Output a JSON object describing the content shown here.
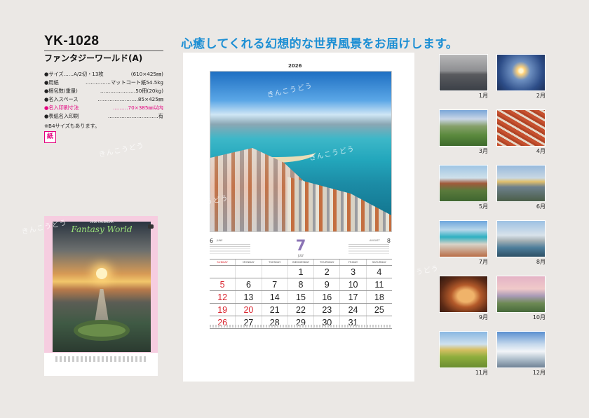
{
  "product": {
    "code": "YK-1028",
    "name": "ファンタジーワールド(A)",
    "specs": [
      {
        "label": "●サイズ……A/2切・13枚",
        "value": "(610×425㎜)",
        "highlight": false
      },
      {
        "label": "●用紙",
        "value": "……………マットコート紙54.5kg",
        "highlight": false
      },
      {
        "label": "●梱包数(重量)",
        "value": "…………………50冊(20kg)",
        "highlight": false
      },
      {
        "label": "●名入スペース",
        "value": "……………………85×425㎜",
        "highlight": false
      },
      {
        "label": "●名入印刷寸法",
        "value": "………70×385㎜以内",
        "highlight": true
      },
      {
        "label": "●表紙名入印刷",
        "value": "…………………………有",
        "highlight": false
      }
    ],
    "note": "※B4サイズもあります。",
    "paper_badge": "紙"
  },
  "cover": {
    "title": "Fantasy World",
    "subtitle": "2026 CALENDAR"
  },
  "headline": "心癒してくれる幻想的な世界風景をお届けします。",
  "calendar": {
    "year": "2026",
    "month_number": "7",
    "month_name": "JULY",
    "prev_month": {
      "number": "6",
      "name": "JUNE"
    },
    "next_month": {
      "number": "8",
      "name": "AUGUST"
    },
    "weekdays": [
      "SUNDAY",
      "MONDAY",
      "TUESDAY",
      "WEDNESDAY",
      "THURSDAY",
      "FRIDAY",
      "SATURDAY"
    ],
    "weeks": [
      [
        "",
        "",
        "",
        "1",
        "2",
        "3",
        "4"
      ],
      [
        "5",
        "6",
        "7",
        "8",
        "9",
        "10",
        "11"
      ],
      [
        "12",
        "13",
        "14",
        "15",
        "16",
        "17",
        "18"
      ],
      [
        "19",
        "20",
        "21",
        "22",
        "23",
        "24",
        "25"
      ],
      [
        "26",
        "27",
        "28",
        "29",
        "30",
        "31",
        ""
      ]
    ],
    "holidays": [
      "20"
    ],
    "accent_color": "#8b74b5",
    "sunday_color": "#d9242e"
  },
  "thumbnails": [
    {
      "label": "1月"
    },
    {
      "label": "2月"
    },
    {
      "label": "3月"
    },
    {
      "label": "4月"
    },
    {
      "label": "5月"
    },
    {
      "label": "6月"
    },
    {
      "label": "7月"
    },
    {
      "label": "8月"
    },
    {
      "label": "9月"
    },
    {
      "label": "10月"
    },
    {
      "label": "11月"
    },
    {
      "label": "12月"
    }
  ],
  "watermark": "きんこうどう",
  "colors": {
    "headline": "#1d8fd4",
    "highlight": "#e4007f",
    "background": "#ebe8e5"
  }
}
